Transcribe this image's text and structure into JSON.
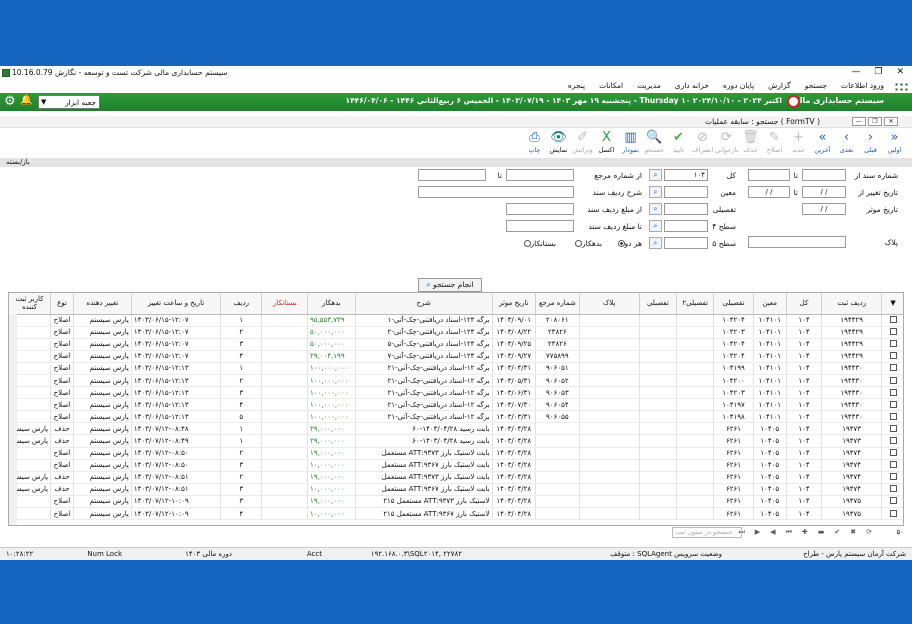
{
  "window": {
    "title": "سیستم حسابداری مالی شرکت تست و توسعه - نگارش 10.16.0.79",
    "controls": [
      "—",
      "❐",
      "✕"
    ]
  },
  "menu": [
    "ورود اطلاعات",
    "جستجو",
    "گزارش",
    "پایان دوره",
    "خزانه داری",
    "مدیریت",
    "امکانات",
    "پنجره"
  ],
  "header": {
    "system_title": "سیستم حسابداری مالی",
    "date_line": "پنجشنبه ۱۹ مهر ۱۴۰۳ - ۱۴۰۳/۰۷/۱۹ - الخميس ۶ ربيع‌الثاني ۱۴۴۶ - ۱۴۴۶/۰۴/۰۶ - Thursday ۱۰ اکتبر ۲۰۲۴ - ۲۰۲۴/۱۰/۱۰",
    "toolbox_label": "جعبه ابزار"
  },
  "inner_window": {
    "title": "جستجو : سابقه عملیات ( FormTV )"
  },
  "toolbar": [
    {
      "label": "اولین",
      "icon": "»",
      "color": "blue",
      "enabled": true
    },
    {
      "label": "قبلی",
      "icon": "›",
      "color": "blue",
      "enabled": true
    },
    {
      "label": "بعدی",
      "icon": "‹",
      "color": "blue",
      "enabled": true
    },
    {
      "label": "آخرین",
      "icon": "«",
      "color": "blue",
      "enabled": true
    },
    {
      "label": "جدید",
      "icon": "+",
      "color": "green",
      "enabled": false
    },
    {
      "label": "اصلاح",
      "icon": "✎",
      "color": "blue",
      "enabled": false
    },
    {
      "label": "حذف",
      "icon": "🗑",
      "color": "red",
      "enabled": false
    },
    {
      "label": "بازخوانی",
      "icon": "⟳",
      "color": "blue",
      "enabled": false
    },
    {
      "label": "انصراف",
      "icon": "⊘",
      "color": "blue",
      "enabled": false
    },
    {
      "label": "تایید",
      "icon": "✔",
      "color": "green",
      "enabled": false
    },
    {
      "label": "جستجو",
      "icon": "🔍",
      "color": "blue",
      "enabled": false
    },
    {
      "label": "نمودار",
      "icon": "▥",
      "color": "blue",
      "enabled": true
    },
    {
      "label": "اکسل",
      "icon": "X",
      "color": "green",
      "enabled": true
    },
    {
      "label": "ویرایش",
      "icon": "✐",
      "color": "blue",
      "enabled": false
    },
    {
      "label": "نمایش",
      "icon": "👁",
      "color": "teal",
      "enabled": true
    },
    {
      "label": "چاپ",
      "icon": "⎙",
      "color": "blue",
      "enabled": true
    }
  ],
  "section_label": "باز/بسته",
  "filters": {
    "doc_no_from_label": "شماره سند از",
    "to_label": "تا",
    "change_date_from_label": "تاریخ تغییر از",
    "effective_date_label": "تاریخ موثر",
    "plate_label": "پلاک",
    "kol_label": "کل",
    "kol_value": "۱۰۴",
    "moin_label": "معین",
    "tafsili_label": "تفصیلی",
    "level4_label": "سطح ۴",
    "level5_label": "سطح ۵",
    "ref_no_from_label": "از شماره مرجع",
    "row_desc_label": "شرح ردیف سند",
    "amount_from_label": "از مبلغ ردیف سند",
    "amount_to_label": "تا مبلغ ردیف سند",
    "date_placeholder": "/ /",
    "radio_both": "هر دو",
    "radio_debit": "بدهکار",
    "radio_credit": "بستانکار",
    "apply_label": "انجام جستجو"
  },
  "grid": {
    "columns": [
      "ردیف ثبت",
      "کل",
      "معین",
      "تفصیلی",
      "تفصیلی۲",
      "تفصیلی",
      "پلاک",
      "شماره مرجع",
      "تاریخ موثر",
      "شرح",
      "بدهکار",
      "بستانکار",
      "ردیف",
      "تاریخ و ساعت تغییر",
      "تغییر دهنده",
      "نوع",
      "کاربر ثبت کننده"
    ],
    "rows": [
      [
        "۱۹۴۴۲۹",
        "۱۰۴",
        "۱۰۴۱۰۱",
        "۱۰۴۲۰۴",
        "",
        "",
        "",
        "۲۰۸۰۶۱",
        "۱۴۰۳/۰۹/۰۱",
        "برگه ۱۲۴-اسناد دریافتنی-چک-آتی-۱",
        "۹۵,۵۵۳,۷۳۹",
        "",
        "۱",
        "۱۴۰۳/۰۶/۱۵-۱۲:۰۷",
        "پارس سیستم",
        "اصلاح",
        ""
      ],
      [
        "۱۹۴۴۲۹",
        "۱۰۴",
        "۱۰۴۱۰۱",
        "۱۰۴۲۰۳",
        "",
        "",
        "",
        "۲۳۸۲۶",
        "۱۴۰۳/۰۸/۲۲",
        "برگه ۱۲۴-اسناد دریافتنی-چک-آتی-۲",
        "۵۰,۰۰۰,۰۰۰",
        "",
        "۲",
        "۱۴۰۳/۰۶/۱۵-۱۲:۰۷",
        "پارس سیستم",
        "اصلاح",
        ""
      ],
      [
        "۱۹۴۴۲۹",
        "۱۰۴",
        "۱۰۴۱۰۱",
        "۱۰۴۲۰۴",
        "",
        "",
        "",
        "۲۳۸۲۶",
        "۱۴۰۳/۰۹/۲۵",
        "برگه ۱۲۴-اسناد دریافتنی-چک-آتی-۵",
        "۵۰,۰۰۰,۰۰۰",
        "",
        "۳",
        "۱۴۰۳/۰۶/۱۵-۱۲:۰۷",
        "پارس سیستم",
        "اصلاح",
        ""
      ],
      [
        "۱۹۴۴۲۹",
        "۱۰۴",
        "۱۰۴۱۰۱",
        "۱۰۴۲۰۴",
        "",
        "",
        "",
        "۷۷۵۸۹۹",
        "۱۴۰۳/۰۹/۲۷",
        "برگه ۱۲۴-اسناد دریافتنی-چک-آتی-۷",
        "۲۹,۰۰۴,۱۹۹",
        "",
        "۴",
        "۱۴۰۳/۰۶/۱۵-۱۲:۰۷",
        "پارس سیستم",
        "اصلاح",
        ""
      ],
      [
        "۱۹۴۴۳۰",
        "۱۰۴",
        "۱۰۴۱۰۱",
        "۱۰۴۱۹۹",
        "",
        "",
        "",
        "۹۰۶۰۵۱",
        "۱۴۰۳/۰۴/۳۱",
        "برگه ۱۲-اسناد دریافتنی-چک-آتی-۲۱",
        "۱۰۰,۰۰۰,۰۰۰",
        "",
        "۱",
        "۱۴۰۳/۰۶/۱۵-۱۲:۱۳",
        "پارس سیستم",
        "اصلاح",
        ""
      ],
      [
        "۱۹۴۴۳۰",
        "۱۰۴",
        "۱۰۴۱۰۱",
        "۱۰۴۲۰۰",
        "",
        "",
        "",
        "۹۰۶۰۵۲",
        "۱۴۰۳/۰۵/۳۱",
        "برگه ۱۲-اسناد دریافتنی-چک-آتی-۲۱",
        "۱۰۰,۰۰۰,۰۰۰",
        "",
        "۲",
        "۱۴۰۳/۰۶/۱۵-۱۲:۱۳",
        "پارس سیستم",
        "اصلاح",
        ""
      ],
      [
        "۱۹۴۴۳۰",
        "۱۰۴",
        "۱۰۴۱۰۱",
        "۱۰۴۲۰۳",
        "",
        "",
        "",
        "۹۰۶۰۵۳",
        "۱۴۰۳/۰۶/۳۱",
        "برگه ۱۲-اسناد دریافتنی-چک-آتی-۲۱",
        "۱۰۰,۰۰۰,۰۰۰",
        "",
        "۳",
        "۱۴۰۳/۰۶/۱۵-۱۲:۱۳",
        "پارس سیستم",
        "اصلاح",
        ""
      ],
      [
        "۱۹۴۴۳۰",
        "۱۰۴",
        "۱۰۴۱۰۱",
        "۱۰۴۱۹۷",
        "",
        "",
        "",
        "۹۰۶۰۵۴",
        "۱۴۰۳/۰۷/۳۰",
        "برگه ۱۲-اسناد دریافتنی-چک-آتی-۲۱",
        "۱۰۰,۰۰۰,۰۰۰",
        "",
        "۴",
        "۱۴۰۳/۰۶/۱۵-۱۲:۱۳",
        "پارس سیستم",
        "اصلاح",
        ""
      ],
      [
        "۱۹۴۴۳۰",
        "۱۰۴",
        "۱۰۴۱۰۱",
        "۱۰۴۱۹۸",
        "",
        "",
        "",
        "۹۰۶۰۵۵",
        "۱۴۰۳/۰۳/۳۱",
        "برگه ۱۲-اسناد دریافتنی-چک-آتی-۲۱",
        "۱۰۰,۰۰۰,۰۰۰",
        "",
        "۵",
        "۱۴۰۳/۰۶/۱۵-۱۲:۱۳",
        "پارس سیستم",
        "اصلاح",
        ""
      ],
      [
        "۱۹۴۷۳",
        "۱۰۴",
        "۱۰۴۰۵",
        "۶۲۶۱",
        "",
        "",
        "",
        "",
        "۱۴۰۳/۰۴/۲۸",
        "بابت رسید ۱۴۰۳/۰۴/۲۸-۶۰",
        "۲۹,۰۰۰,۰۰۰",
        "",
        "۱",
        "۱۴۰۳/۰۷/۱۲-۰۸:۴۸",
        "پارس سیستم",
        "حذف",
        "پارس سیستم"
      ],
      [
        "۱۹۴۷۳",
        "۱۰۴",
        "۱۰۴۰۵",
        "۶۲۶۱",
        "",
        "",
        "",
        "",
        "۱۴۰۳/۰۴/۲۸",
        "بابت رسید ۱۴۰۳/۰۴/۲۸-۶۰",
        "۲۹,۰۰۰,۰۰۰",
        "",
        "۱",
        "۱۴۰۳/۰۷/۱۲-۰۸:۴۹",
        "پارس سیستم",
        "حذف",
        "پارس سیستم"
      ],
      [
        "۱۹۴۷۴",
        "۱۰۴",
        "۱۰۴۰۵",
        "۶۲۶۱",
        "",
        "",
        "",
        "",
        "۱۴۰۳/۰۴/۲۸",
        "بابت لاستیک بارز ۹۳۷۳:ATT مستعمل",
        "۱۹,۰۰۰,۰۰۰",
        "",
        "۲",
        "۱۴۰۳/۰۷/۱۲-۰۸:۵۰",
        "پارس سیستم",
        "اصلاح",
        ""
      ],
      [
        "۱۹۴۷۴",
        "۱۰۴",
        "۱۰۴۰۵",
        "۶۲۶۱",
        "",
        "",
        "",
        "",
        "۱۴۰۳/۰۴/۲۸",
        "بابت لاستیک بارز ۹۳۶۷:ATT مستعمل",
        "۱۰,۰۰۰,۰۰۰",
        "",
        "۳",
        "۱۴۰۳/۰۷/۱۲-۰۸:۵۰",
        "پارس سیستم",
        "اصلاح",
        ""
      ],
      [
        "۱۹۴۷۴",
        "۱۰۴",
        "۱۰۴۰۵",
        "۶۲۶۱",
        "",
        "",
        "",
        "",
        "۱۴۰۳/۰۴/۲۸",
        "بابت لاستیک بارز ۹۳۷۳:ATT مستعمل",
        "۱۹,۰۰۰,۰۰۰",
        "",
        "۲",
        "۱۴۰۳/۰۷/۱۲-۰۸:۵۱",
        "پارس سیستم",
        "حذف",
        "پارس سیستم"
      ],
      [
        "۱۹۴۷۴",
        "۱۰۴",
        "۱۰۴۰۵",
        "۶۲۶۱",
        "",
        "",
        "",
        "",
        "۱۴۰۳/۰۴/۲۸",
        "بابت لاستیک بارز ۹۳۶۷:ATT مستعمل",
        "۱۰,۰۰۰,۰۰۰",
        "",
        "۳",
        "۱۴۰۳/۰۷/۱۲-۰۸:۵۱",
        "پارس سیستم",
        "حذف",
        "پارس سیستم"
      ],
      [
        "۱۹۴۷۵",
        "۱۰۴",
        "۱۰۴۰۵",
        "۶۲۶۱",
        "",
        "",
        "",
        "",
        "۱۴۰۳/۰۴/۲۸",
        "لاستیک بارز ۹۳۷۳:ATT مستعمل ۲۱۵",
        "۱۹,۰۰۰,۰۰۰",
        "",
        "۳",
        "۱۴۰۳/۰۷/۱۲-۱۰:۰۹",
        "پارس سیستم",
        "اصلاح",
        ""
      ],
      [
        "۱۹۴۷۵",
        "۱۰۴",
        "۱۰۴۰۵",
        "۶۲۶۱",
        "",
        "",
        "",
        "",
        "۱۴۰۳/۰۴/۲۸",
        "لاستیک بارز ۹۳۶۷:ATT مستعمل ۲۱۵",
        "۱۰,۰۰۰,۰۰۰",
        "",
        "۴",
        "۱۴۰۳/۰۷/۱۲-۱۰:۰۹",
        "پارس سیستم",
        "اصلاح",
        ""
      ]
    ]
  },
  "pager": {
    "search_placeholder": "جستجو در ستون ثبت",
    "count": "۵۰"
  },
  "status": {
    "company": "شرکت آرمان سیستم پارس - طراح",
    "sqlagent": "متوقف : SQLAgent وضعیت سرویس",
    "server": "۱۹۲.۱۶۸.۰.۳\\SQL۲۰۱۴, ۲۲۷۸۲",
    "acct": "Acct",
    "period": "دوره مالی ۱۴۰۳",
    "numlock": "Num Lock",
    "time": "۱۰:۲۸:۲۲"
  }
}
